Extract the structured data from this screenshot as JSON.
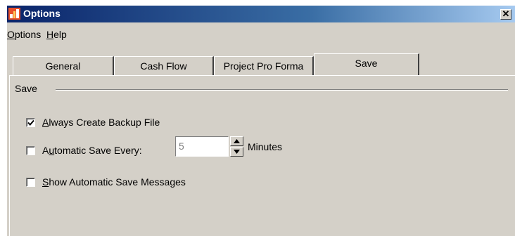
{
  "window": {
    "title": "Options",
    "close_glyph": "✕",
    "icon": "app-logo-icon"
  },
  "menu": [
    {
      "label": "Options",
      "mnemonic": "O",
      "rest": "ptions"
    },
    {
      "label": "Help",
      "mnemonic": "H",
      "rest": "elp"
    }
  ],
  "tabs": [
    {
      "label": "General",
      "active": false
    },
    {
      "label": "Cash Flow",
      "active": false
    },
    {
      "label": "Project Pro Forma",
      "active": false
    },
    {
      "label": "Save",
      "active": true
    }
  ],
  "save_group": {
    "label": "Save",
    "always_backup": {
      "label": "Always Create Backup File",
      "mnemonic": "A",
      "rest": "lways Create Backup File",
      "checked": true
    },
    "auto_save": {
      "label": "Automatic Save Every:",
      "pre": "A",
      "mnemonic": "u",
      "rest": "tomatic Save Every:",
      "checked": false,
      "value": "5",
      "unit_label": "Minutes"
    },
    "show_messages": {
      "label": "Show Automatic Save Messages",
      "mnemonic": "S",
      "rest": "how Automatic Save Messages",
      "checked": false
    }
  },
  "colors": {
    "face": "#d4d0c8",
    "title_start": "#0a246a",
    "title_end": "#a6caf0"
  }
}
